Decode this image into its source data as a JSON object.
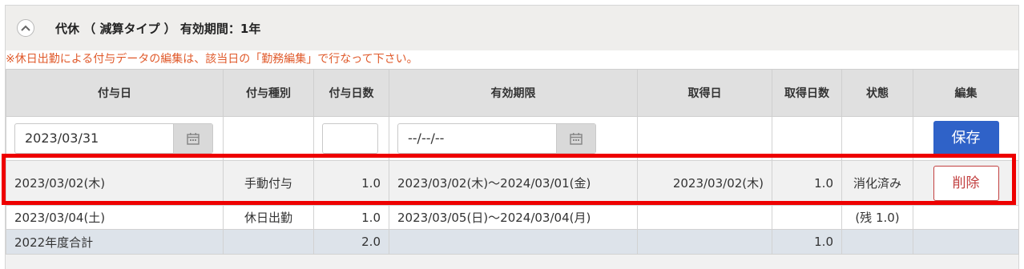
{
  "panel": {
    "title": "代休 （ 減算タイプ ） 有効期間：1年",
    "notice": "※休日出勤による付与データの編集は、該当日の「勤務編集」で行なって下さい。"
  },
  "table": {
    "headers": [
      "付与日",
      "付与種別",
      "付与日数",
      "有効期限",
      "取得日",
      "取得日数",
      "状態",
      "編集"
    ],
    "input_row": {
      "grant_date": "2023/03/31",
      "days": "",
      "expiry": "--/--/--",
      "save_label": "保存"
    },
    "rows": [
      {
        "grant_date": "2023/03/02(木)",
        "type": "手動付与",
        "days": "1.0",
        "period": "2023/03/02(木)～2024/03/01(金)",
        "taken_date": "2023/03/02(木)",
        "taken_days": "1.0",
        "status": "消化済み",
        "action": "削除"
      },
      {
        "grant_date": "2023/03/04(土)",
        "type": "休日出勤",
        "days": "1.0",
        "period": "2023/03/05(日)～2024/03/04(月)",
        "taken_date": "",
        "taken_days": "",
        "status": "(残 1.0)",
        "action": ""
      }
    ],
    "total": {
      "label": "2022年度合計",
      "days": "2.0",
      "taken_days": "1.0"
    }
  },
  "colors": {
    "save": "#2f62c8",
    "delete": "#c24040",
    "notice": "#e05a2b",
    "highlight": "#ee0000"
  }
}
